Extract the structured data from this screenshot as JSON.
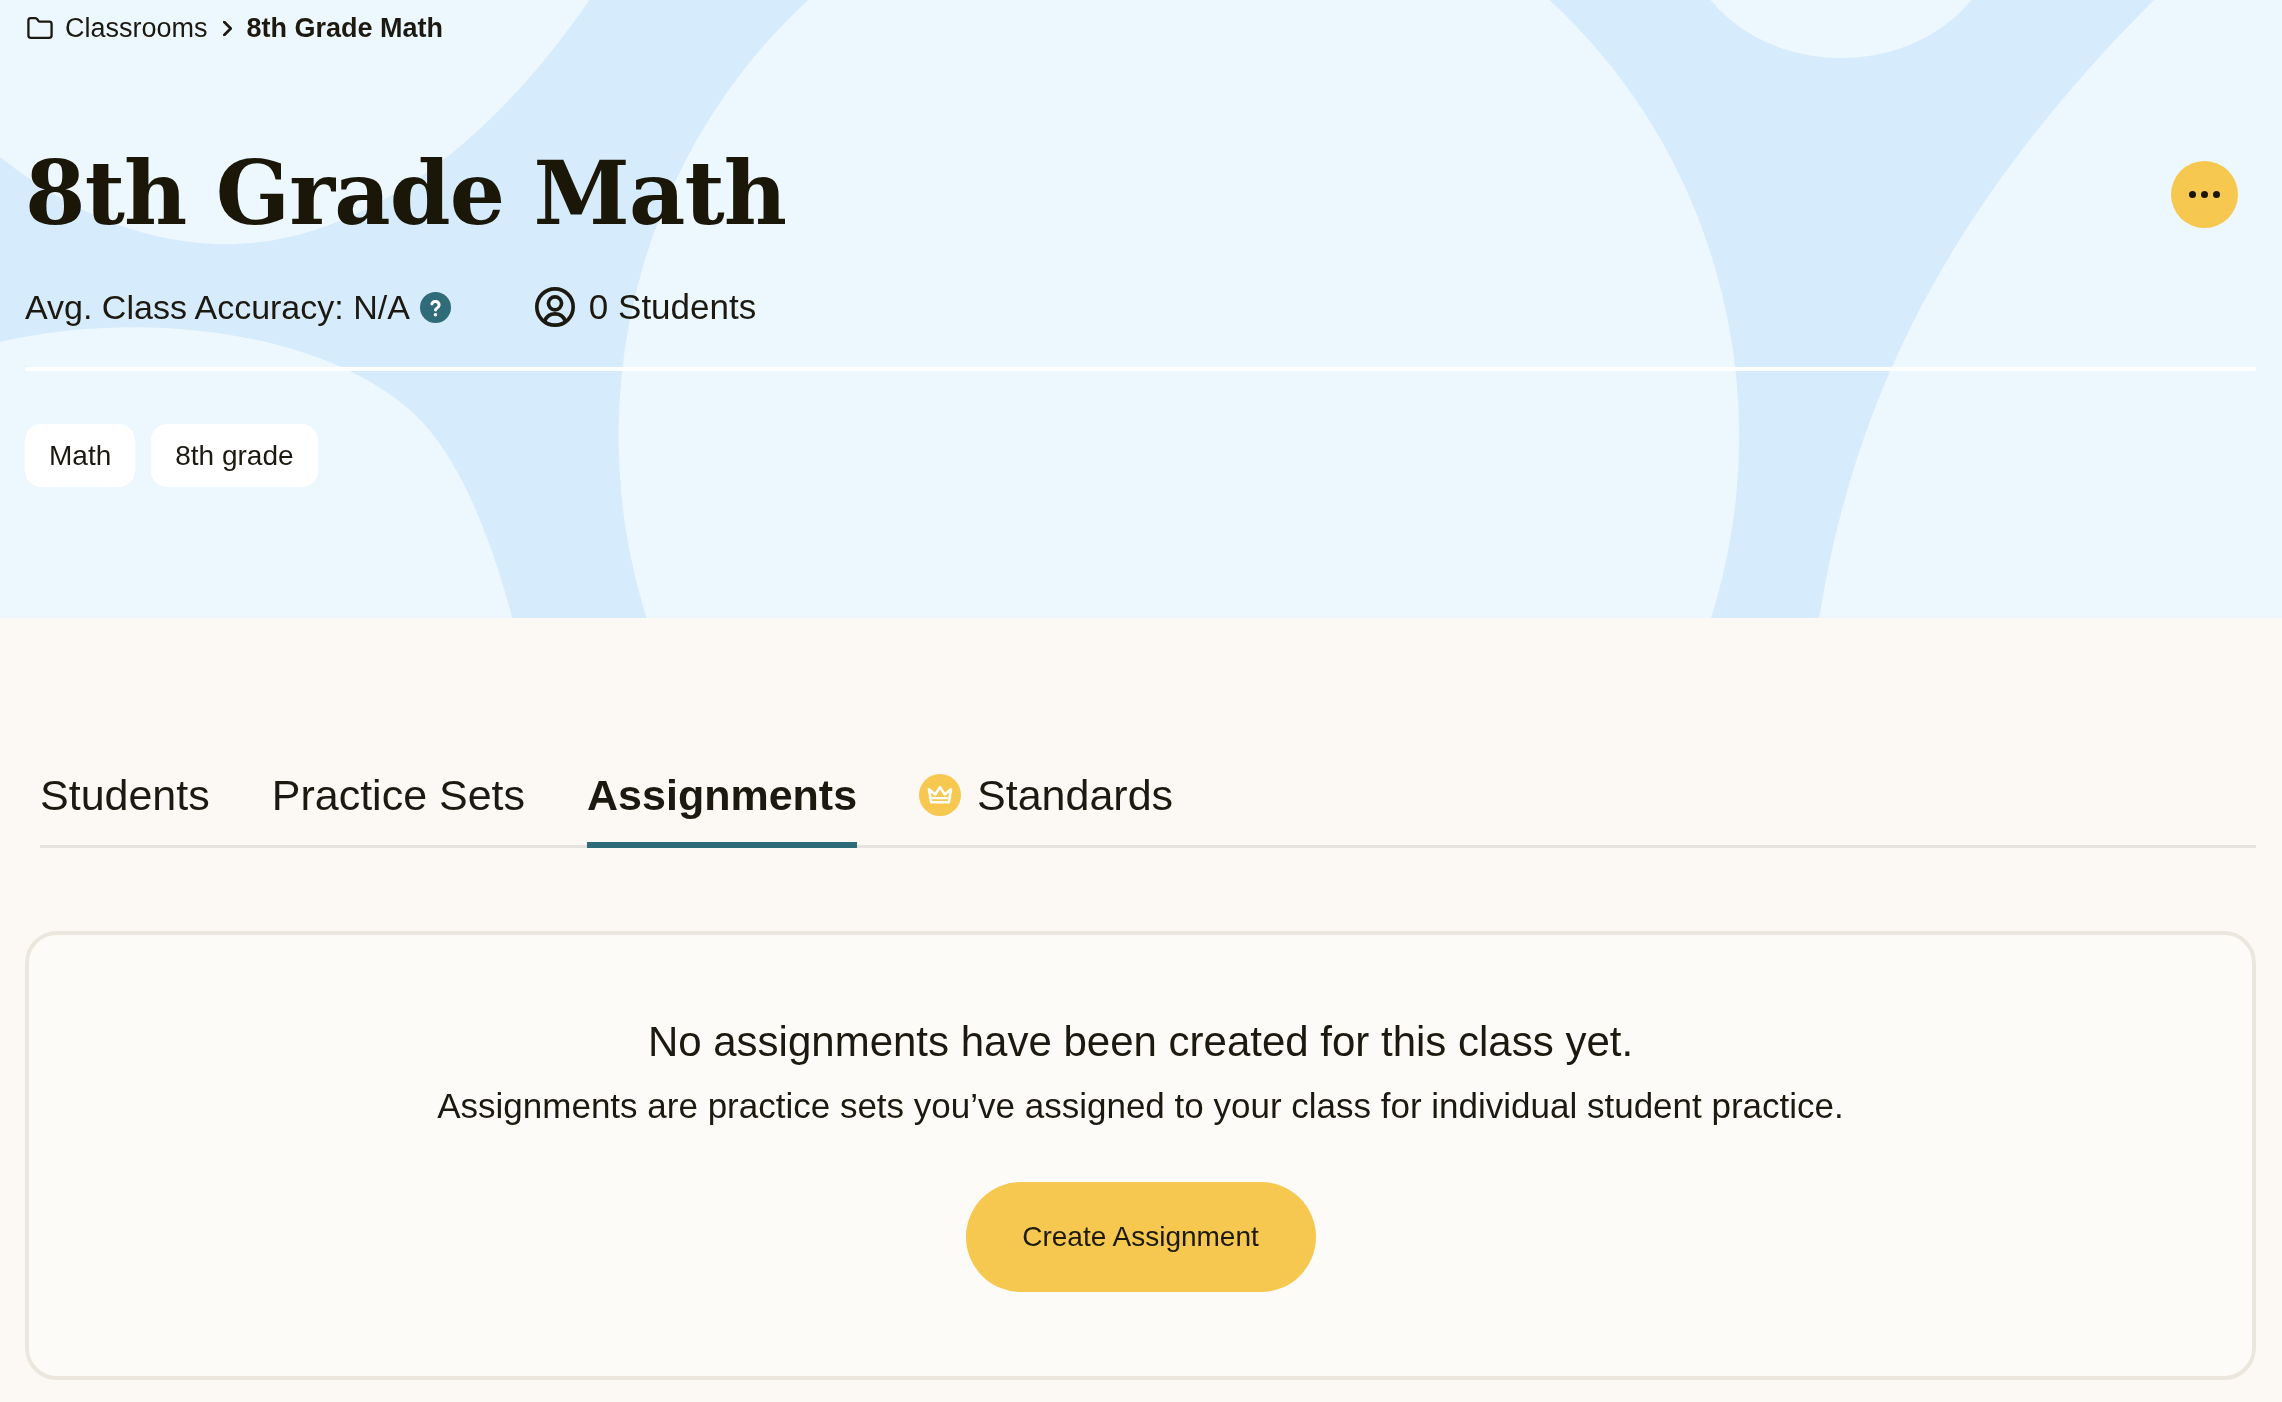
{
  "breadcrumb": [
    {
      "label": "Classrooms",
      "current": false
    },
    {
      "label": "8th Grade Math",
      "current": true
    }
  ],
  "header": {
    "title": "8th Grade Math",
    "accuracy": "Avg. Class Accuracy: N/A",
    "students": "0 Students"
  },
  "tags": [
    "Math",
    "8th grade"
  ],
  "tabs": [
    {
      "label": "Students",
      "selected": false,
      "kind": "text"
    },
    {
      "label": "Practice Sets",
      "selected": false,
      "kind": "text"
    },
    {
      "label": "Assignments",
      "selected": true,
      "kind": "text"
    },
    {
      "label": "Standards",
      "selected": false,
      "kind": "premium"
    }
  ],
  "empty_state": {
    "title": "No assignments have been created for this class yet.",
    "description": "Assignments are practice sets you’ve assigned to your class for individual student practice.",
    "button": "Create Assignment"
  }
}
